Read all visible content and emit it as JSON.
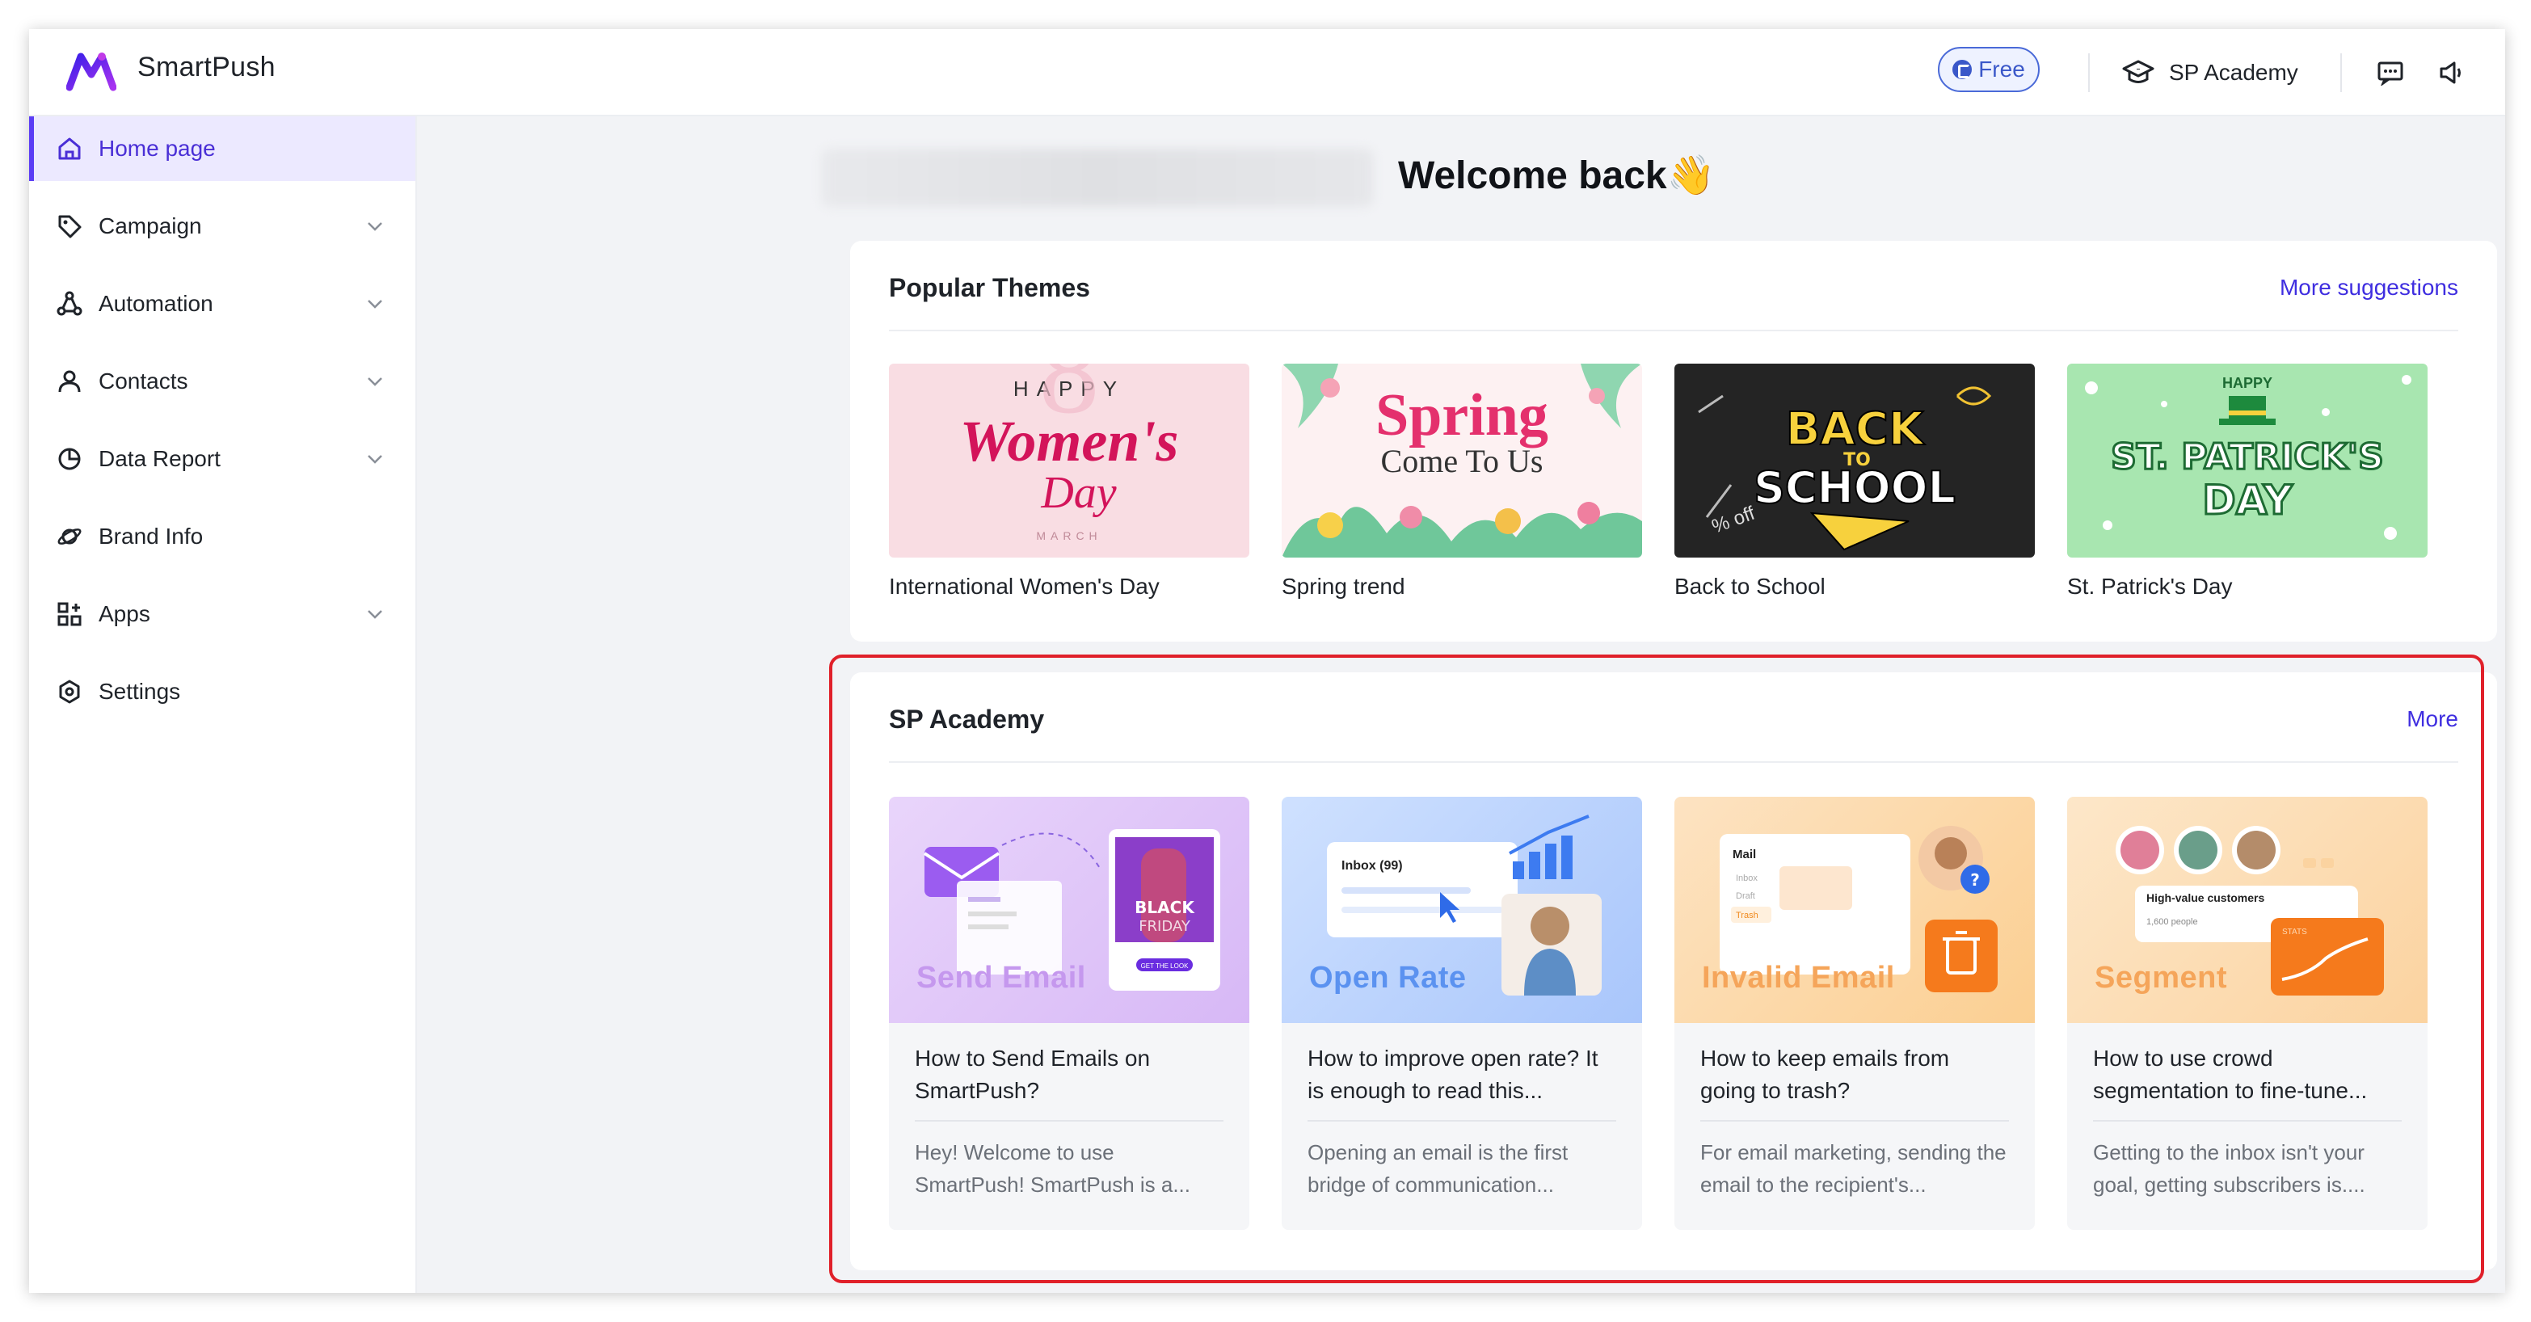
{
  "header": {
    "brand": "SmartPush",
    "plan_badge": "Free",
    "academy_link": "SP Academy"
  },
  "sidebar": {
    "items": [
      {
        "label": "Home page",
        "icon": "home-icon",
        "active": true,
        "expandable": false
      },
      {
        "label": "Campaign",
        "icon": "tag-icon",
        "active": false,
        "expandable": true
      },
      {
        "label": "Automation",
        "icon": "automation-icon",
        "active": false,
        "expandable": true
      },
      {
        "label": "Contacts",
        "icon": "user-icon",
        "active": false,
        "expandable": true
      },
      {
        "label": "Data Report",
        "icon": "pie-chart-icon",
        "active": false,
        "expandable": true
      },
      {
        "label": "Brand Info",
        "icon": "planet-icon",
        "active": false,
        "expandable": false
      },
      {
        "label": "Apps",
        "icon": "apps-icon",
        "active": false,
        "expandable": true
      },
      {
        "label": "Settings",
        "icon": "settings-icon",
        "active": false,
        "expandable": false
      }
    ]
  },
  "main": {
    "welcome": "Welcome back👋",
    "popular_themes": {
      "title": "Popular Themes",
      "link": "More suggestions",
      "items": [
        {
          "label": "International Women's Day",
          "art": {
            "line1": "HAPPY",
            "line2": "Women's",
            "line3": "Day",
            "line4": "MARCH"
          }
        },
        {
          "label": "Spring trend",
          "art": {
            "line1": "Spring",
            "line2": "Come To Us"
          }
        },
        {
          "label": "Back to School",
          "art": {
            "line1": "BACK",
            "line2": "TO",
            "line3": "SCHOOL",
            "line4": "% off"
          }
        },
        {
          "label": "St. Patrick's Day",
          "art": {
            "line1": "HAPPY",
            "line2": "ST. PATRICK'S",
            "line3": "DAY"
          }
        }
      ]
    },
    "academy": {
      "title": "SP Academy",
      "link": "More",
      "lessons": [
        {
          "overlay": "Send Email",
          "title": "How to Send Emails on SmartPush?",
          "desc": "Hey! Welcome to use SmartPush! SmartPush is a...",
          "art": {
            "promo1": "BLACK",
            "promo2": "FRIDAY",
            "cta": "GET THE LOOK"
          }
        },
        {
          "overlay": "Open Rate",
          "title": "How to improve open rate? It is enough to read this...",
          "desc": "Opening an email is the first bridge of communication...",
          "art": {
            "inbox": "Inbox (99)"
          }
        },
        {
          "overlay": "Invalid Email",
          "title": "How to keep emails from going to trash?",
          "desc": "For email marketing, sending the email to the recipient's...",
          "art": {
            "mail": "Mail",
            "f1": "Inbox",
            "f2": "Draft",
            "f3": "Trash"
          }
        },
        {
          "overlay": "Segment",
          "title": "How to use crowd segmentation to fine-tune...",
          "desc": "Getting to the inbox isn't your goal, getting subscribers is....",
          "art": {
            "seg_title": "High-value customers",
            "seg_count": "1,600 people",
            "stats": "STATS"
          }
        }
      ]
    }
  },
  "colors": {
    "accent": "#5b3df5",
    "link": "#3f2ee0",
    "highlight": "#e0202a",
    "free_badge": "#3b58c9"
  }
}
